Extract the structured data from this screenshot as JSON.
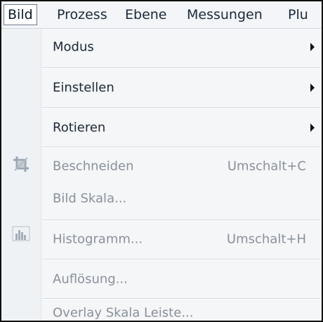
{
  "menubar": {
    "items": [
      "Bild",
      "Prozess",
      "Ebene",
      "Messungen",
      "Plu"
    ]
  },
  "menu": {
    "modus": "Modus",
    "einstellen": "Einstellen",
    "rotieren": "Rotieren",
    "beschneiden": "Beschneiden",
    "beschneiden_shortcut": "Umschalt+C",
    "bild_skala": "Bild Skala...",
    "histogramm": "Histogramm...",
    "histogramm_shortcut": "Umschalt+H",
    "aufloesung": "Auflösung...",
    "overlay_skala": "Overlay Skala Leiste..."
  },
  "icons": {
    "crop": "crop-icon",
    "histogram": "histogram-icon"
  }
}
